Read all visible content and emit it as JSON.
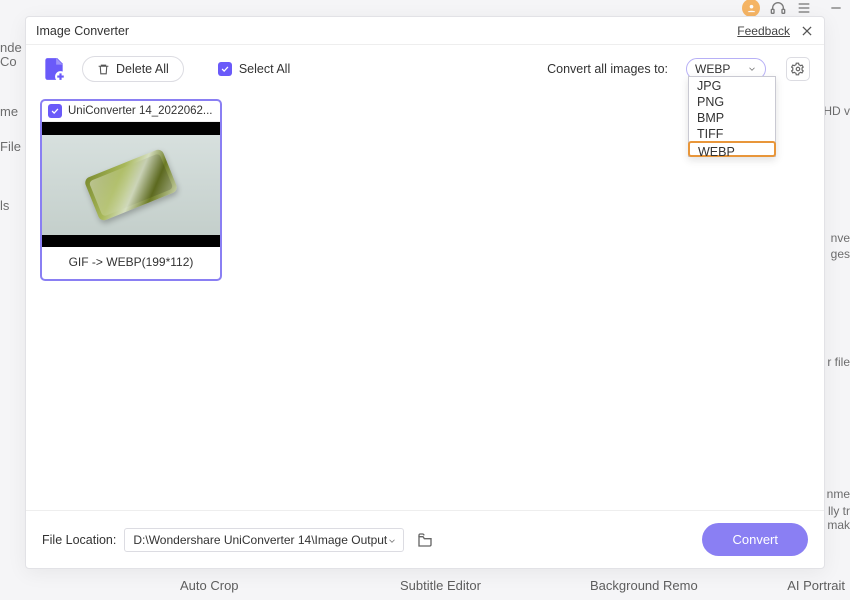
{
  "bg": {
    "left": {
      "l1": "nde",
      "l2": "Co",
      "l3": "me",
      "l4": "File",
      "l5": "ls"
    },
    "right": {
      "r1": "HD v",
      "r2": "nve",
      "r3": "ges",
      "r4": "r file",
      "r5": "nme",
      "r6": "lly tr",
      "r7": " mak"
    },
    "bottom": {
      "autocrop": "Auto Crop",
      "subed": "Subtitle Editor",
      "bgremo": "Background Remo",
      "aiport": "AI Portrait"
    }
  },
  "modal": {
    "title": "Image Converter",
    "feedback": "Feedback"
  },
  "toolbar": {
    "delete_all": "Delete All",
    "select_all": "Select All",
    "convert_label": "Convert all images to:",
    "format_selected": "WEBP"
  },
  "dropdown": {
    "options": [
      "JPG",
      "PNG",
      "BMP",
      "TIFF",
      "WEBP"
    ],
    "highlighted": "WEBP"
  },
  "item": {
    "name": "UniConverter 14_2022062...",
    "conversion": "GIF -> WEBP(199*112)"
  },
  "footer": {
    "file_location_label": "File Location:",
    "path": "D:\\Wondershare UniConverter 14\\Image Output",
    "convert_label": "Convert"
  }
}
